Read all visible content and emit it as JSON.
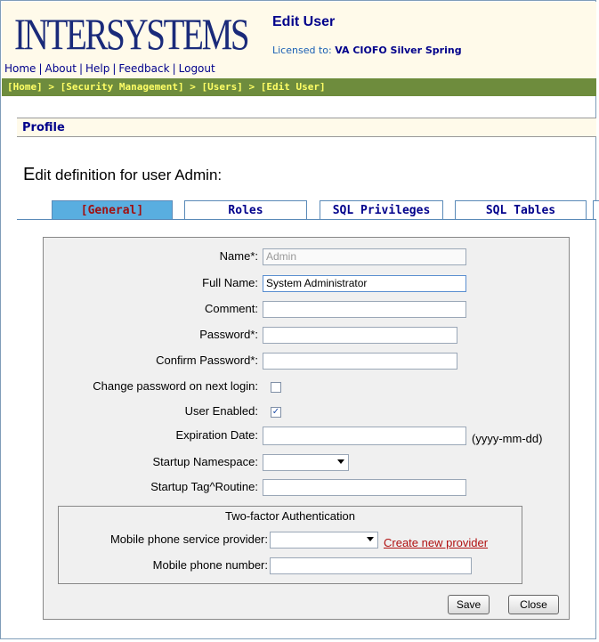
{
  "header": {
    "logo": "INTERSYSTEMS",
    "title": "Edit User",
    "license_label": "Licensed to:",
    "license_value": "VA CIOFO Silver Spring",
    "nav": [
      "Home",
      "About",
      "Help",
      "Feedback",
      "Logout"
    ]
  },
  "breadcrumb": "[Home] > [Security Management] > [Users] > [Edit User]",
  "profile": {
    "label": "Profile"
  },
  "heading": {
    "first_letter": "E",
    "rest": "dit definition for user Admin:"
  },
  "tabs": [
    "[General]",
    "Roles",
    "SQL Privileges",
    "SQL Tables"
  ],
  "form": {
    "name_label": "Name*:",
    "name_value": "Admin",
    "fullname_label": "Full Name:",
    "fullname_value": "System Administrator",
    "comment_label": "Comment:",
    "comment_value": "",
    "password_label": "Password*:",
    "confirm_label": "Confirm Password*:",
    "change_pw_label": "Change password on next login:",
    "change_pw_checked": false,
    "enabled_label": "User Enabled:",
    "enabled_checked": true,
    "expiration_label": "Expiration Date:",
    "expiration_value": "",
    "expiration_hint": "(yyyy-mm-dd)",
    "namespace_label": "Startup Namespace:",
    "namespace_value": "",
    "routine_label": "Startup Tag^Routine:",
    "routine_value": ""
  },
  "twofactor": {
    "title": "Two-factor Authentication",
    "provider_label": "Mobile phone service provider:",
    "provider_value": "",
    "create_link": "Create new provider",
    "phone_label": "Mobile phone number:",
    "phone_value": ""
  },
  "buttons": {
    "save": "Save",
    "close": "Close"
  }
}
